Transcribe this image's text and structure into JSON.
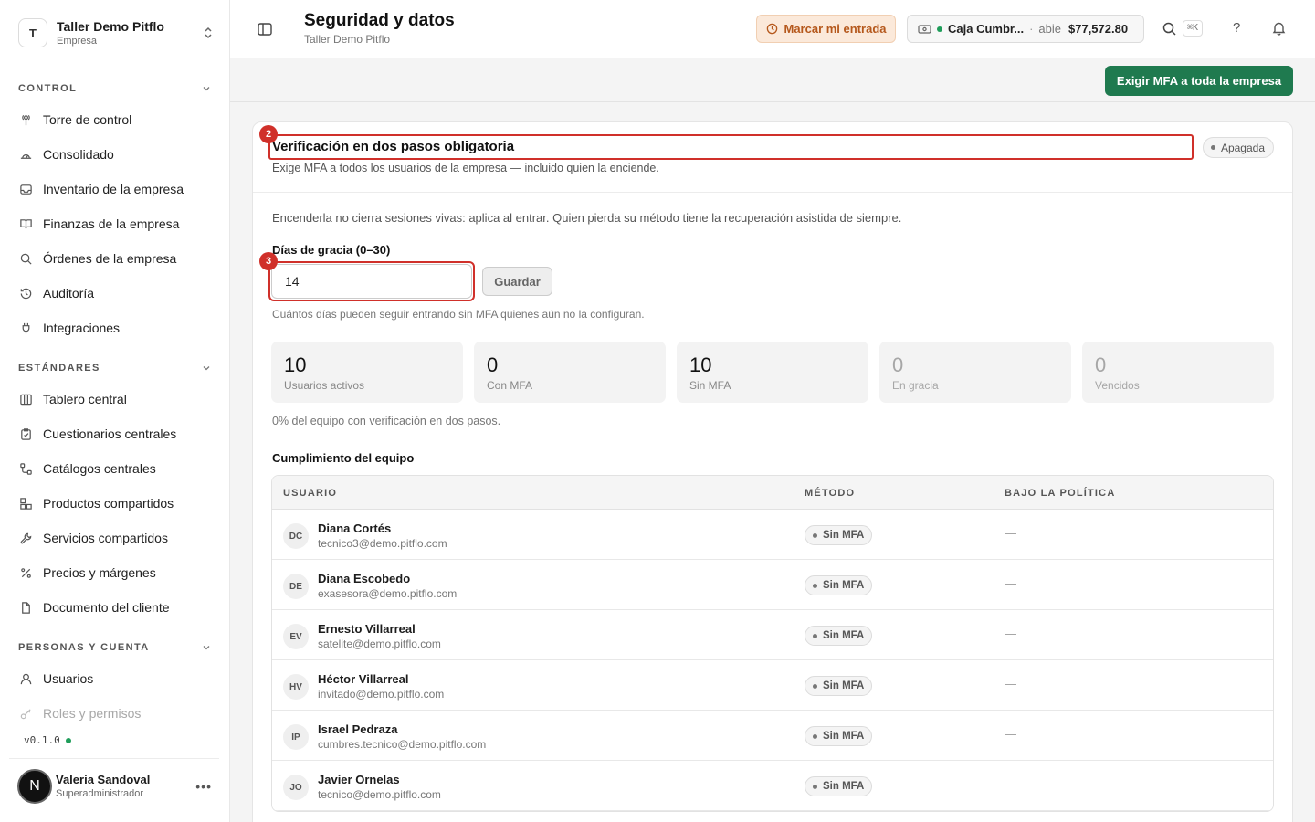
{
  "sidebar": {
    "org": {
      "initial": "T",
      "name": "Taller Demo Pitflo",
      "subtitle": "Empresa"
    },
    "sections": [
      {
        "label": "CONTROL"
      },
      {
        "label": "ESTÁNDARES"
      },
      {
        "label": "PERSONAS Y CUENTA"
      }
    ],
    "items": [
      {
        "label": "Torre de control",
        "icon": "tower-icon"
      },
      {
        "label": "Consolidado",
        "icon": "chart-icon"
      },
      {
        "label": "Inventario de la empresa",
        "icon": "inbox-icon"
      },
      {
        "label": "Finanzas de la empresa",
        "icon": "book-icon"
      },
      {
        "label": "Órdenes de la empresa",
        "icon": "search-icon"
      },
      {
        "label": "Auditoría",
        "icon": "history-icon"
      },
      {
        "label": "Integraciones",
        "icon": "plug-icon"
      },
      {
        "label": "Tablero central",
        "icon": "columns-icon"
      },
      {
        "label": "Cuestionarios centrales",
        "icon": "clipboard-icon"
      },
      {
        "label": "Catálogos centrales",
        "icon": "hierarchy-icon"
      },
      {
        "label": "Productos compartidos",
        "icon": "boxes-icon"
      },
      {
        "label": "Servicios compartidos",
        "icon": "wrench-icon"
      },
      {
        "label": "Precios y márgenes",
        "icon": "percent-icon"
      },
      {
        "label": "Documento del cliente",
        "icon": "document-icon"
      },
      {
        "label": "Usuarios",
        "icon": "user-icon"
      },
      {
        "label": "Roles y permisos",
        "icon": "key-icon"
      }
    ],
    "version": "v0.1.0",
    "user": {
      "initial": "N",
      "name": "Valeria Sandoval",
      "role": "Superadministrador"
    }
  },
  "header": {
    "title": "Seguridad y datos",
    "subtitle": "Taller Demo Pitflo",
    "clock_label": "Marcar mi entrada",
    "cash": {
      "name": "Caja Cumbr...",
      "sep": "·",
      "status": "abie",
      "amount": "$77,572.80"
    },
    "shortcut": "⌘K",
    "help": "?"
  },
  "actions": {
    "enforce_label": "Exigir MFA a toda la empresa"
  },
  "card": {
    "title": "Verificación en dos pasos obligatoria",
    "description": "Exige MFA a todos los usuarios de la empresa — incluido quien la enciende.",
    "status": "Apagada",
    "note": "Encenderla no cierra sesiones vivas: aplica al entrar. Quien pierda su método tiene la recuperación asistida de siempre.",
    "grace_label": "Días de gracia (0–30)",
    "grace_value": "14",
    "save_label": "Guardar",
    "grace_help": "Cuántos días pueden seguir entrando sin MFA quienes aún no la configuran.",
    "coverage": "0% del equipo con verificación en dos pasos.",
    "team_title": "Cumplimiento del equipo"
  },
  "annotations": {
    "title_marker": "2",
    "input_marker": "3"
  },
  "stats": [
    {
      "value": "10",
      "label": "Usuarios activos"
    },
    {
      "value": "0",
      "label": "Con MFA"
    },
    {
      "value": "10",
      "label": "Sin MFA"
    },
    {
      "value": "0",
      "label": "En gracia"
    },
    {
      "value": "0",
      "label": "Vencidos"
    }
  ],
  "table": {
    "columns": [
      "USUARIO",
      "MÉTODO",
      "BAJO LA POLÍTICA"
    ],
    "rows": [
      {
        "initials": "DC",
        "name": "Diana Cortés",
        "email": "tecnico3@demo.pitflo.com",
        "method": "Sin MFA",
        "policy": "—"
      },
      {
        "initials": "DE",
        "name": "Diana Escobedo",
        "email": "exasesora@demo.pitflo.com",
        "method": "Sin MFA",
        "policy": "—"
      },
      {
        "initials": "EV",
        "name": "Ernesto Villarreal",
        "email": "satelite@demo.pitflo.com",
        "method": "Sin MFA",
        "policy": "—"
      },
      {
        "initials": "HV",
        "name": "Héctor Villarreal",
        "email": "invitado@demo.pitflo.com",
        "method": "Sin MFA",
        "policy": "—"
      },
      {
        "initials": "IP",
        "name": "Israel Pedraza",
        "email": "cumbres.tecnico@demo.pitflo.com",
        "method": "Sin MFA",
        "policy": "—"
      },
      {
        "initials": "JO",
        "name": "Javier Ornelas",
        "email": "tecnico@demo.pitflo.com",
        "method": "Sin MFA",
        "policy": "—"
      }
    ]
  },
  "colors": {
    "accent": "#1f7a4f",
    "annotation": "#d0302a",
    "clock_bg": "#fbe9da",
    "clock_text": "#b5581c",
    "online": "#1f9d5a"
  }
}
